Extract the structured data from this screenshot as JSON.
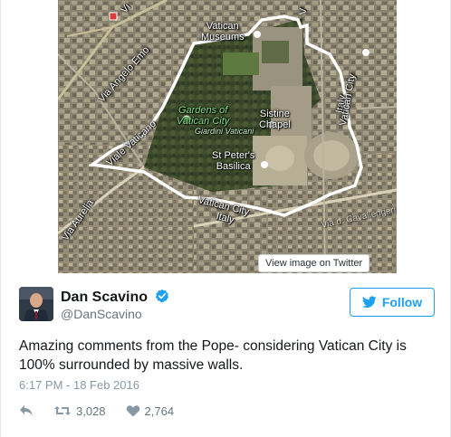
{
  "map": {
    "labels": {
      "vatican_museums": "Vatican\nMuseums",
      "via_angelo_emo": "Via Angelo Emo",
      "viale_vaticano": "Viale Vaticano",
      "via_aurelia": "Via Aurelia",
      "gardens": "Gardens of\nVatican City",
      "giardini": "Giardini Vaticani",
      "sistine": "Sistine\nChapel",
      "st_peters": "St Peter's\nBasilica",
      "vatican_city": "Vatican City",
      "italy_bottom": "Italy",
      "italy_right": "Italy",
      "vatican_city_right": "Vatican City",
      "vi_top": "Vi",
      "v_top": "V",
      "via_caval": "Via d. Cavalleggeri"
    }
  },
  "media": {
    "view_image_label": "View image on Twitter"
  },
  "tweet": {
    "author_name": "Dan Scavino",
    "author_handle": "@DanScavino",
    "follow_label": "Follow",
    "text": "Amazing comments from the Pope- considering Vatican City is 100% surrounded by massive walls.",
    "timestamp": "6:17 PM - 18 Feb 2016",
    "retweets": "3,028",
    "likes": "2,764"
  },
  "colors": {
    "brand_blue": "#1da1f2",
    "verified_blue": "#1da1f2",
    "muted_gray": "#8899a6"
  },
  "icons": {
    "reply": "reply-icon",
    "retweet": "retweet-icon",
    "like": "heart-icon",
    "verified": "verified-badge-icon",
    "bird": "twitter-bird-icon"
  }
}
